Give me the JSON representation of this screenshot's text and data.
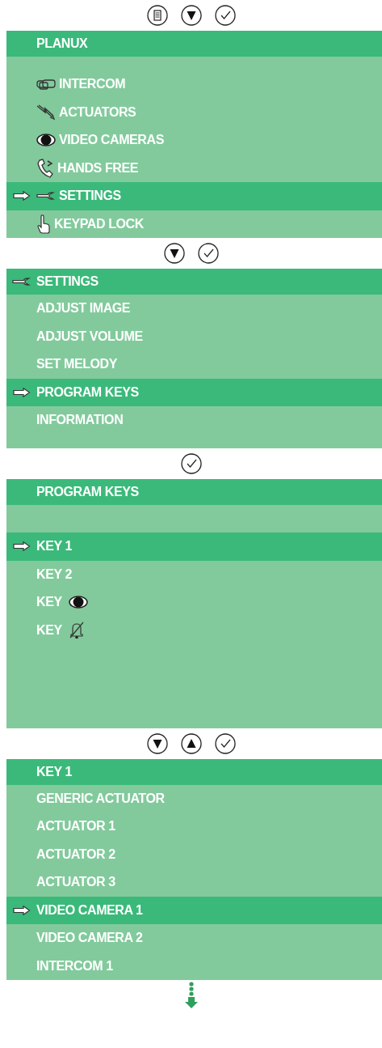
{
  "screens": [
    {
      "buttons": [
        {
          "kind": "menu"
        },
        {
          "kind": "down"
        },
        {
          "kind": "ok"
        }
      ],
      "title": {
        "kind": "plain",
        "label": "PLANUX"
      },
      "items": [
        {
          "kind": "gap"
        },
        {
          "kind": "intercom",
          "label": "INTERCOM",
          "selected": false
        },
        {
          "kind": "actuators",
          "label": "ACTUATORS",
          "selected": false
        },
        {
          "kind": "cameras",
          "label": "VIDEO CAMERAS",
          "selected": false
        },
        {
          "kind": "handsfree",
          "label": "HANDS FREE",
          "selected": false
        },
        {
          "kind": "settings",
          "label": "SETTINGS",
          "selected": true
        },
        {
          "kind": "keypadlock",
          "label": "KEYPAD LOCK",
          "selected": false
        }
      ]
    },
    {
      "buttons": [
        {
          "kind": "down"
        },
        {
          "kind": "ok"
        }
      ],
      "title": {
        "kind": "settings",
        "label": "SETTINGS"
      },
      "items": [
        {
          "kind": "plain",
          "label": "ADJUST IMAGE",
          "selected": false
        },
        {
          "kind": "plain",
          "label": "ADJUST VOLUME",
          "selected": false
        },
        {
          "kind": "plain",
          "label": "SET MELODY",
          "selected": false
        },
        {
          "kind": "plain",
          "label": "PROGRAM KEYS",
          "selected": true
        },
        {
          "kind": "plain",
          "label": "INFORMATION",
          "selected": false
        },
        {
          "kind": "gap"
        }
      ]
    },
    {
      "buttons": [
        {
          "kind": "ok"
        }
      ],
      "title": {
        "kind": "plain",
        "label": "PROGRAM KEYS"
      },
      "items": [
        {
          "kind": "blank"
        },
        {
          "kind": "plain",
          "label": "KEY 1",
          "selected": true
        },
        {
          "kind": "plain",
          "label": "KEY 2",
          "selected": false
        },
        {
          "kind": "camerakey",
          "label": "KEY",
          "selected": false
        },
        {
          "kind": "mutekey",
          "label": "KEY",
          "selected": false
        },
        {
          "kind": "blank"
        },
        {
          "kind": "blank"
        },
        {
          "kind": "blank"
        }
      ]
    },
    {
      "buttons": [
        {
          "kind": "down"
        },
        {
          "kind": "up"
        },
        {
          "kind": "ok"
        }
      ],
      "title": {
        "kind": "plain",
        "label": "KEY 1"
      },
      "items": [
        {
          "kind": "plain",
          "label": "GENERIC ACTUATOR",
          "selected": false
        },
        {
          "kind": "plain",
          "label": "ACTUATOR 1",
          "selected": false
        },
        {
          "kind": "plain",
          "label": "ACTUATOR 2",
          "selected": false
        },
        {
          "kind": "plain",
          "label": "ACTUATOR 3",
          "selected": false
        },
        {
          "kind": "plain",
          "label": "VIDEO CAMERA 1",
          "selected": true
        },
        {
          "kind": "plain",
          "label": "VIDEO CAMERA 2",
          "selected": false
        },
        {
          "kind": "plain",
          "label": "INTERCOM 1",
          "selected": false
        }
      ],
      "more_below": true
    }
  ]
}
